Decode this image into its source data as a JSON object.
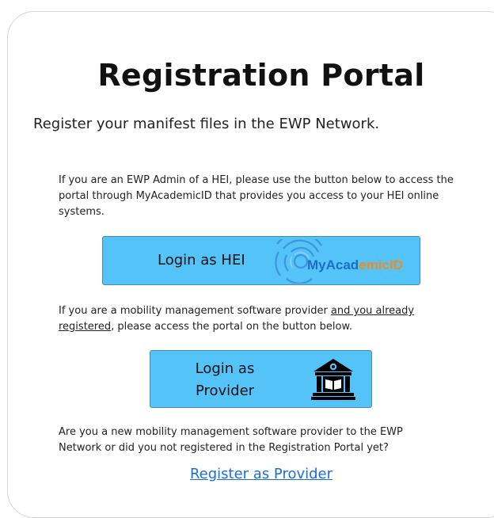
{
  "page": {
    "title": "Registration Portal",
    "subtitle": "Register your manifest files in the EWP Network."
  },
  "hei_section": {
    "description": "If you are an EWP Admin of a HEI, please use the button below to access the portal through MyAcademicID that provides you access to your HEI online systems.",
    "button_label": "Login as HEI",
    "logo_text_prefix": "MyAcad",
    "logo_text_emph": "emic",
    "logo_text_id": "ID",
    "logo_icon": "myacademicid-logo"
  },
  "provider_section": {
    "description_start": "If you are a mobility management software provider ",
    "description_underlined": "and you already registered",
    "description_end": ", please access the portal on the button below.",
    "button_label_line1": "Login as",
    "button_label_line2": "Provider",
    "button_icon": "institution-icon"
  },
  "new_provider_section": {
    "description": "Are you a new mobility management software provider to the EWP Network or did you not registered in the Registration Portal yet?",
    "link_label": "Register as Provider"
  },
  "colors": {
    "button_bg": "#54c3f7",
    "button_border": "#4a8bb2",
    "link": "#1a6fd6",
    "logo_blue": "#1e6fc4",
    "logo_orange": "#f08a24"
  }
}
